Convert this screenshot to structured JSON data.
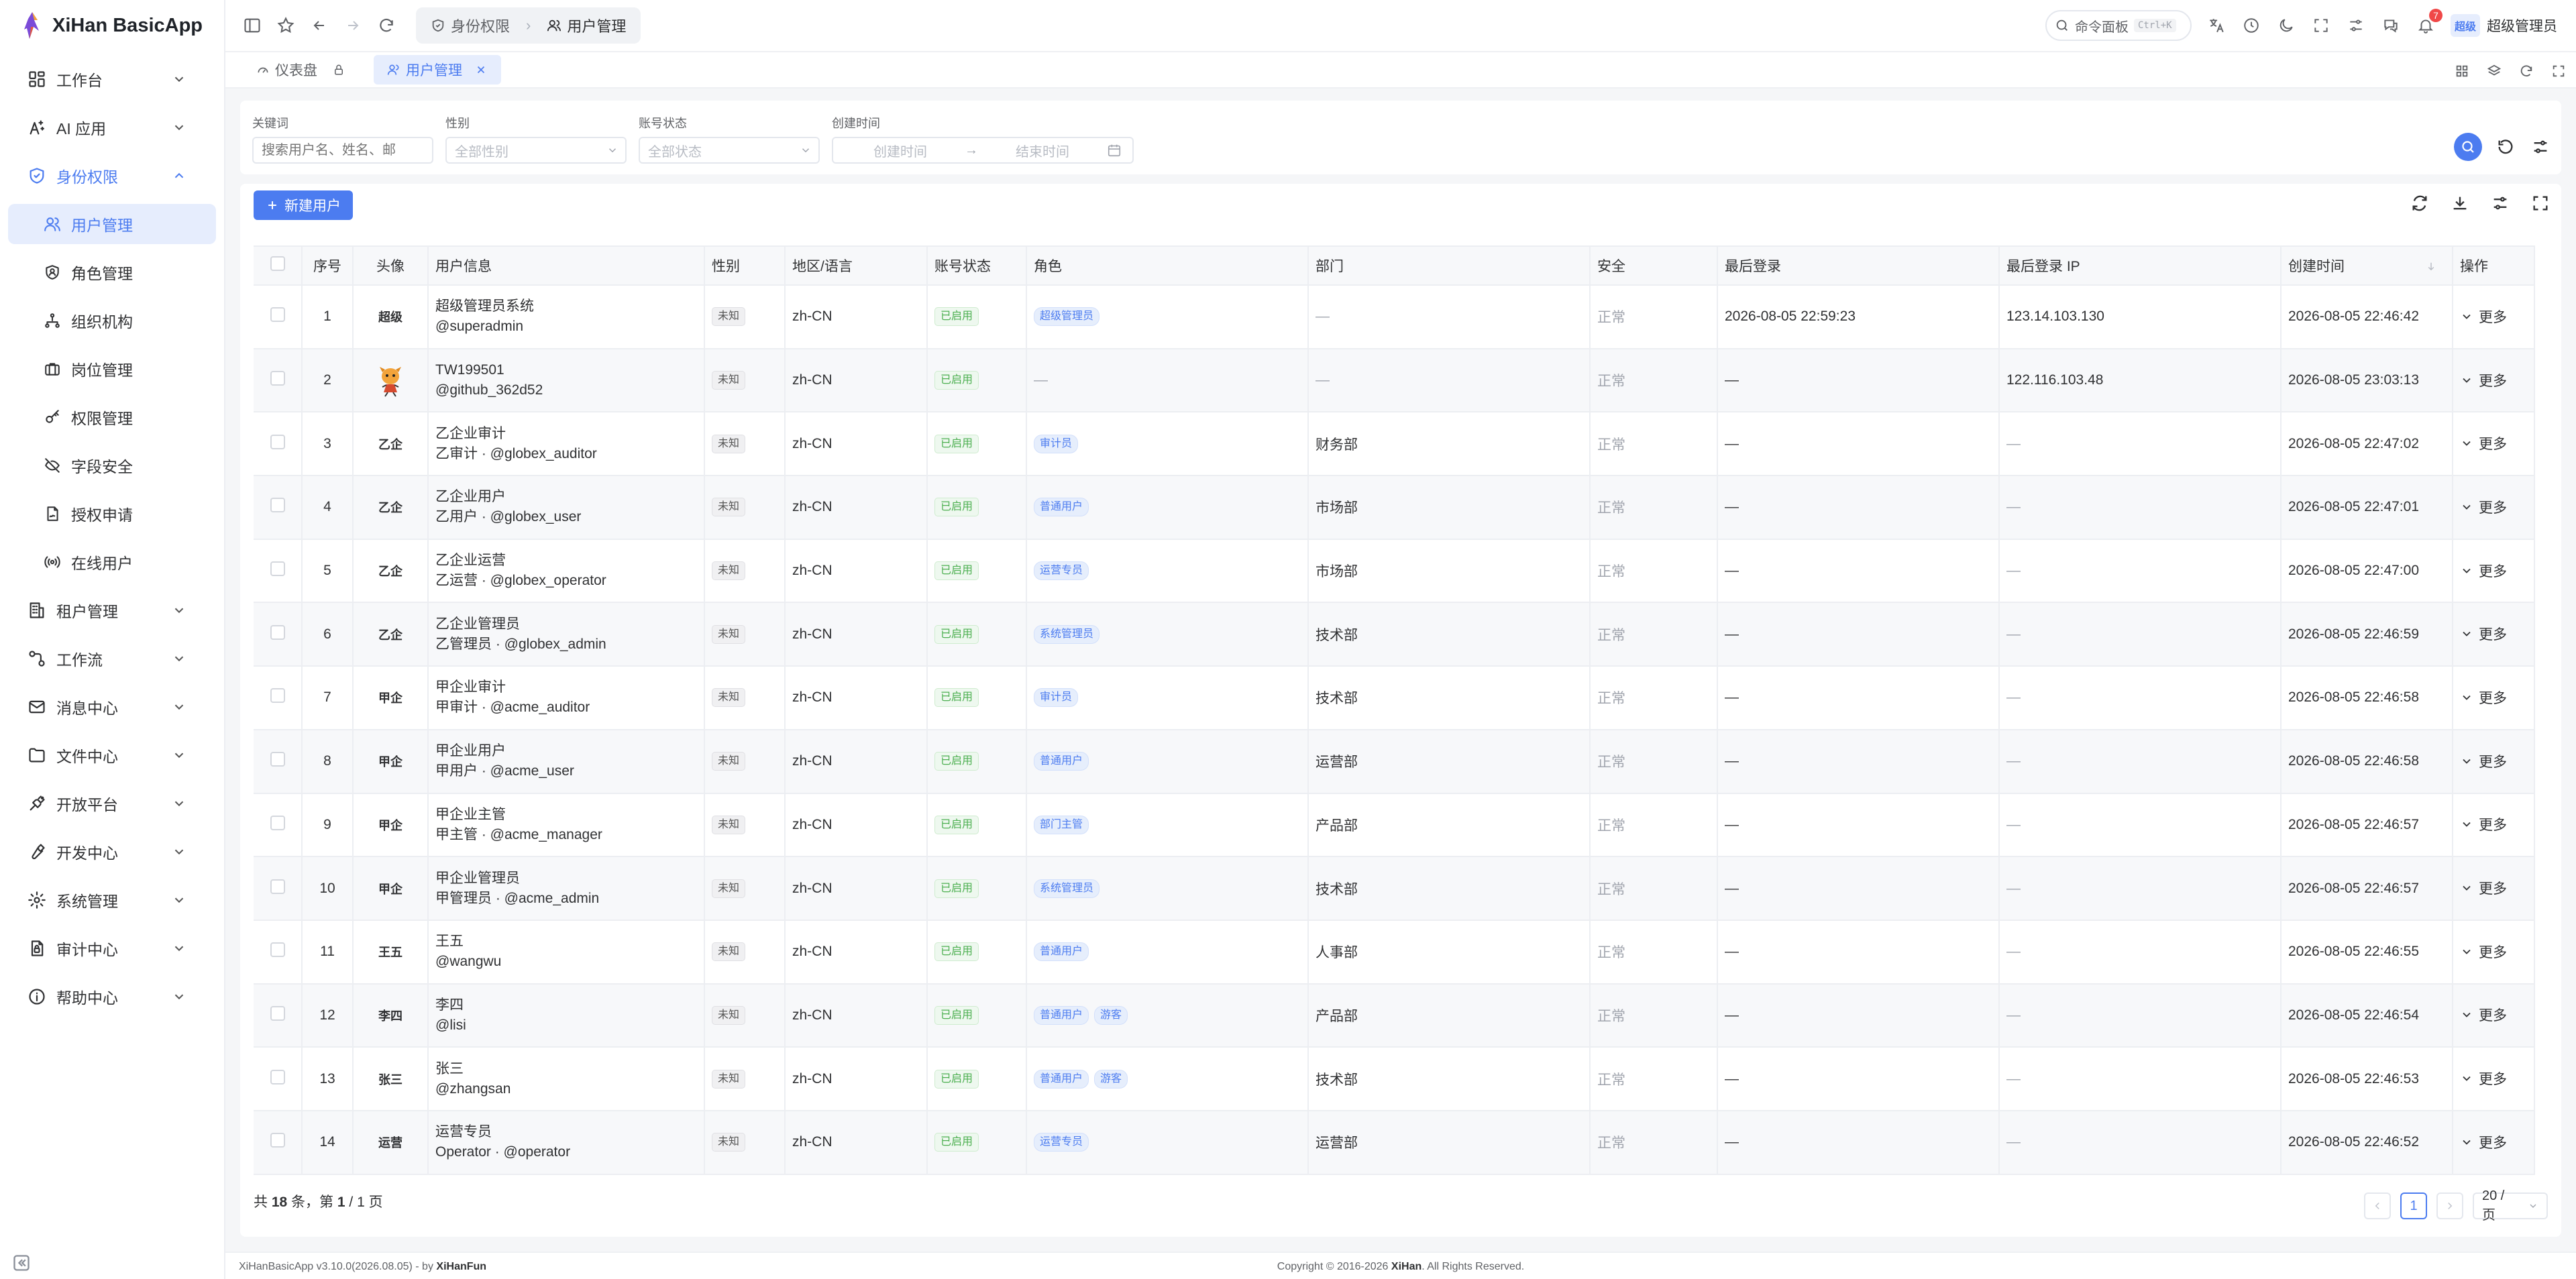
{
  "app": {
    "name": "XiHan BasicApp"
  },
  "sidebar": {
    "groups": [
      {
        "label": "工作台",
        "icon": "dashboard-icon",
        "open": false
      },
      {
        "label": "AI 应用",
        "icon": "ai-icon",
        "open": false
      },
      {
        "label": "身份权限",
        "icon": "shield-icon",
        "open": true,
        "children": [
          {
            "label": "用户管理",
            "icon": "users-icon",
            "active": true
          },
          {
            "label": "角色管理",
            "icon": "role-icon"
          },
          {
            "label": "组织机构",
            "icon": "org-icon"
          },
          {
            "label": "岗位管理",
            "icon": "briefcase-icon"
          },
          {
            "label": "权限管理",
            "icon": "key-icon"
          },
          {
            "label": "字段安全",
            "icon": "eye-off-icon"
          },
          {
            "label": "授权申请",
            "icon": "file-sign-icon"
          },
          {
            "label": "在线用户",
            "icon": "broadcast-icon"
          }
        ]
      },
      {
        "label": "租户管理",
        "icon": "building-icon",
        "open": false
      },
      {
        "label": "工作流",
        "icon": "workflow-icon",
        "open": false
      },
      {
        "label": "消息中心",
        "icon": "mail-icon",
        "open": false
      },
      {
        "label": "文件中心",
        "icon": "folder-icon",
        "open": false
      },
      {
        "label": "开放平台",
        "icon": "plug-icon",
        "open": false
      },
      {
        "label": "开发中心",
        "icon": "wrench-icon",
        "open": false
      },
      {
        "label": "系统管理",
        "icon": "gear-icon",
        "open": false
      },
      {
        "label": "审计中心",
        "icon": "audit-icon",
        "open": false
      },
      {
        "label": "帮助中心",
        "icon": "info-icon",
        "open": false
      }
    ]
  },
  "header": {
    "breadcrumb": [
      "身份权限",
      "用户管理"
    ],
    "command_label": "命令面板",
    "command_shortcut": "Ctrl+K",
    "notification_count": "7",
    "user_badge": "超级",
    "user_name": "超级管理员"
  },
  "tabs": [
    {
      "label": "仪表盘",
      "active": false,
      "locked": true
    },
    {
      "label": "用户管理",
      "active": true,
      "closable": true
    }
  ],
  "filters": {
    "keyword": {
      "label": "关键词",
      "placeholder": "搜索用户名、姓名、邮"
    },
    "gender": {
      "label": "性别",
      "placeholder": "全部性别"
    },
    "status": {
      "label": "账号状态",
      "placeholder": "全部状态"
    },
    "created": {
      "label": "创建时间",
      "start_placeholder": "创建时间",
      "end_placeholder": "结束时间",
      "arrow": "→"
    }
  },
  "toolbar": {
    "new_user_label": "新建用户"
  },
  "table": {
    "columns": [
      "序号",
      "头像",
      "用户信息",
      "性别",
      "地区/语言",
      "账号状态",
      "角色",
      "部门",
      "安全",
      "最后登录",
      "最后登录 IP",
      "创建时间",
      "操作"
    ],
    "more_label": "更多",
    "rows": [
      {
        "no": "1",
        "avatar": "超级",
        "name": "超级管理员系统",
        "sub": "@superadmin",
        "gender": "未知",
        "locale": "zh-CN",
        "status": "已启用",
        "roles": [
          "超级管理员"
        ],
        "dept": "—",
        "security": "正常",
        "last_login": "2026-08-05 22:59:23",
        "last_ip": "123.14.103.130",
        "created": "2026-08-05 22:46:42"
      },
      {
        "no": "2",
        "avatar": "",
        "avatar_image": true,
        "name": "TW199501",
        "sub": "@github_362d52",
        "gender": "未知",
        "locale": "zh-CN",
        "status": "已启用",
        "roles": [],
        "roles_empty": "—",
        "dept": "—",
        "security": "正常",
        "last_login": "—",
        "last_ip": "122.116.103.48",
        "created": "2026-08-05 23:03:13"
      },
      {
        "no": "3",
        "avatar": "乙企",
        "name": "乙企业审计",
        "sub": "乙审计 · @globex_auditor",
        "gender": "未知",
        "locale": "zh-CN",
        "status": "已启用",
        "roles": [
          "审计员"
        ],
        "dept": "财务部",
        "security": "正常",
        "last_login": "—",
        "last_ip": "—",
        "created": "2026-08-05 22:47:02"
      },
      {
        "no": "4",
        "avatar": "乙企",
        "name": "乙企业用户",
        "sub": "乙用户 · @globex_user",
        "gender": "未知",
        "locale": "zh-CN",
        "status": "已启用",
        "roles": [
          "普通用户"
        ],
        "dept": "市场部",
        "security": "正常",
        "last_login": "—",
        "last_ip": "—",
        "created": "2026-08-05 22:47:01"
      },
      {
        "no": "5",
        "avatar": "乙企",
        "name": "乙企业运营",
        "sub": "乙运营 · @globex_operator",
        "gender": "未知",
        "locale": "zh-CN",
        "status": "已启用",
        "roles": [
          "运营专员"
        ],
        "dept": "市场部",
        "security": "正常",
        "last_login": "—",
        "last_ip": "—",
        "created": "2026-08-05 22:47:00"
      },
      {
        "no": "6",
        "avatar": "乙企",
        "name": "乙企业管理员",
        "sub": "乙管理员 · @globex_admin",
        "gender": "未知",
        "locale": "zh-CN",
        "status": "已启用",
        "roles": [
          "系统管理员"
        ],
        "dept": "技术部",
        "security": "正常",
        "last_login": "—",
        "last_ip": "—",
        "created": "2026-08-05 22:46:59"
      },
      {
        "no": "7",
        "avatar": "甲企",
        "name": "甲企业审计",
        "sub": "甲审计 · @acme_auditor",
        "gender": "未知",
        "locale": "zh-CN",
        "status": "已启用",
        "roles": [
          "审计员"
        ],
        "dept": "技术部",
        "security": "正常",
        "last_login": "—",
        "last_ip": "—",
        "created": "2026-08-05 22:46:58"
      },
      {
        "no": "8",
        "avatar": "甲企",
        "name": "甲企业用户",
        "sub": "甲用户 · @acme_user",
        "gender": "未知",
        "locale": "zh-CN",
        "status": "已启用",
        "roles": [
          "普通用户"
        ],
        "dept": "运营部",
        "security": "正常",
        "last_login": "—",
        "last_ip": "—",
        "created": "2026-08-05 22:46:58"
      },
      {
        "no": "9",
        "avatar": "甲企",
        "name": "甲企业主管",
        "sub": "甲主管 · @acme_manager",
        "gender": "未知",
        "locale": "zh-CN",
        "status": "已启用",
        "roles": [
          "部门主管"
        ],
        "dept": "产品部",
        "security": "正常",
        "last_login": "—",
        "last_ip": "—",
        "created": "2026-08-05 22:46:57"
      },
      {
        "no": "10",
        "avatar": "甲企",
        "name": "甲企业管理员",
        "sub": "甲管理员 · @acme_admin",
        "gender": "未知",
        "locale": "zh-CN",
        "status": "已启用",
        "roles": [
          "系统管理员"
        ],
        "dept": "技术部",
        "security": "正常",
        "last_login": "—",
        "last_ip": "—",
        "created": "2026-08-05 22:46:57"
      },
      {
        "no": "11",
        "avatar": "王五",
        "name": "王五",
        "sub": "@wangwu",
        "gender": "未知",
        "locale": "zh-CN",
        "status": "已启用",
        "roles": [
          "普通用户"
        ],
        "dept": "人事部",
        "security": "正常",
        "last_login": "—",
        "last_ip": "—",
        "created": "2026-08-05 22:46:55"
      },
      {
        "no": "12",
        "avatar": "李四",
        "name": "李四",
        "sub": "@lisi",
        "gender": "未知",
        "locale": "zh-CN",
        "status": "已启用",
        "roles": [
          "普通用户",
          "游客"
        ],
        "dept": "产品部",
        "security": "正常",
        "last_login": "—",
        "last_ip": "—",
        "created": "2026-08-05 22:46:54"
      },
      {
        "no": "13",
        "avatar": "张三",
        "name": "张三",
        "sub": "@zhangsan",
        "gender": "未知",
        "locale": "zh-CN",
        "status": "已启用",
        "roles": [
          "普通用户",
          "游客"
        ],
        "dept": "技术部",
        "security": "正常",
        "last_login": "—",
        "last_ip": "—",
        "created": "2026-08-05 22:46:53"
      },
      {
        "no": "14",
        "avatar": "运营",
        "name": "运营专员",
        "sub": "Operator · @operator",
        "gender": "未知",
        "locale": "zh-CN",
        "status": "已启用",
        "roles": [
          "运营专员"
        ],
        "dept": "运营部",
        "security": "正常",
        "last_login": "—",
        "last_ip": "—",
        "created": "2026-08-05 22:46:52"
      }
    ]
  },
  "pagination": {
    "total_prefix": "共",
    "total": "18",
    "total_suffix": "条，第",
    "page": "1",
    "page_sep": "/",
    "pages": "1",
    "page_suffix": "页",
    "current": "1",
    "size_label": "20 / 页"
  },
  "footer": {
    "left_prefix": "XiHanBasicApp v3.10.0(2026.08.05) - by",
    "left_author": "XiHanFun",
    "copyright_prefix": "Copyright © 2016-2026",
    "copyright_brand": "XiHan",
    "copyright_suffix": ". All Rights Reserved."
  },
  "colors": {
    "primary": "#4c7cf0",
    "success": "#4caf50",
    "danger": "#f04848"
  }
}
